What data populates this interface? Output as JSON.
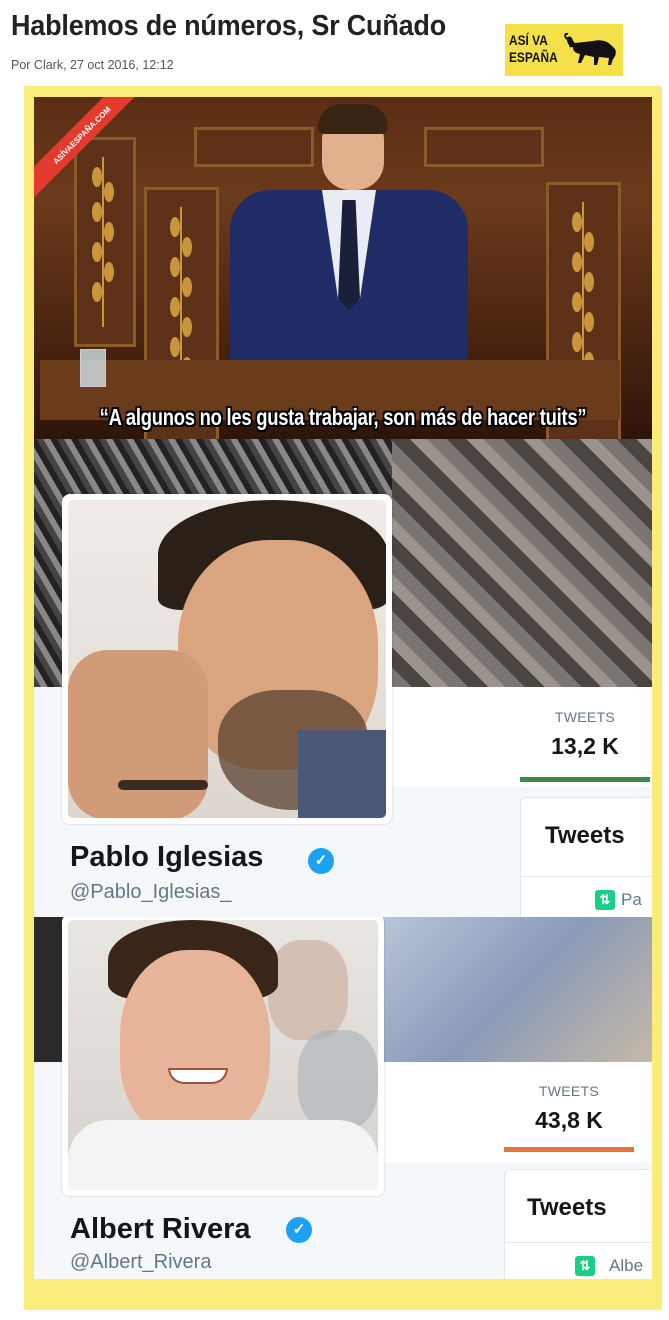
{
  "article": {
    "title": "Hablemos de números, Sr Cuñado",
    "byline": "Por Clark, 27 oct 2016, 12:12"
  },
  "logo": {
    "line1": "ASÍ VA",
    "line2": "ESPAÑA"
  },
  "meme": {
    "watermark": "ASÍVAESPAÑA.COM",
    "caption": "“A algunos no les gusta trabajar, son más de hacer tuits”",
    "profiles": [
      {
        "name": "Pablo Iglesias",
        "handle": "@Pablo_Iglesias_",
        "stat_label": "TWEETS",
        "stat_value": "13,2 K",
        "bar_color": "#3d8b48",
        "tab_title": "Tweets",
        "retweet_preview": "Pa"
      },
      {
        "name": "Albert Rivera",
        "handle": "@Albert_Rivera",
        "stat_label": "TWEETS",
        "stat_value": "43,8 K",
        "bar_color": "#e8743b",
        "tab_title": "Tweets",
        "retweet_preview": "Albe"
      }
    ]
  },
  "colors": {
    "frame": "#f9ec7a",
    "logo_bg": "#f5e04a",
    "verified": "#1da1f2",
    "ribbon": "#e23b2e"
  },
  "icons": [
    "verified-badge-icon",
    "retweet-icon",
    "bull-logo-icon"
  ]
}
